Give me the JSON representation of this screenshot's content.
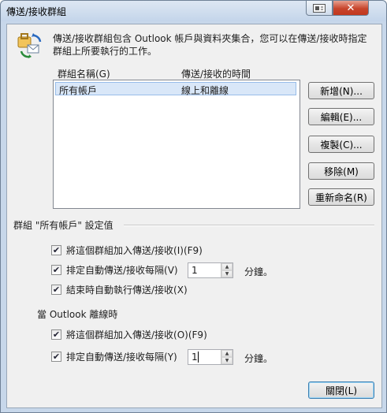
{
  "window": {
    "title": "傳送/接收群組",
    "help_icon": "help-icon",
    "close_icon": "close-icon",
    "close_glyph": "✕"
  },
  "intro": {
    "icon": "send-receive-icon",
    "text": "傳送/接收群組包含 Outlook 帳戶與資料夾集合，您可以在傳送/接收時指定群組上所要執行的工作。"
  },
  "list": {
    "col_name": "群組名稱(G)",
    "col_time": "傳送/接收的時間",
    "rows": [
      {
        "name": "所有帳戶",
        "time": "線上和離線"
      }
    ]
  },
  "buttons": {
    "new": "新增(N)...",
    "edit": "編輯(E)...",
    "copy": "複製(C)...",
    "remove": "移除(M)",
    "rename": "重新命名(R)",
    "close": "關閉(L)"
  },
  "online_settings": {
    "header": "群組 \"所有帳戶\" 設定值",
    "include": {
      "label": "將這個群組加入傳送/接收(I)(F9)",
      "checked": true
    },
    "schedule": {
      "label": "排定自動傳送/接收每隔(V)",
      "checked": true,
      "minutes": "1",
      "unit": "分鐘。"
    },
    "on_exit": {
      "label": "結束時自動執行傳送/接收(X)",
      "checked": true
    }
  },
  "offline_settings": {
    "header": "當 Outlook 離線時",
    "include": {
      "label": "將這個群組加入傳送/接收(O)(F9)",
      "checked": true
    },
    "schedule": {
      "label": "排定自動傳送/接收每隔(Y)",
      "checked": true,
      "minutes": "1",
      "unit": "分鐘。"
    }
  },
  "glyphs": {
    "check": "✔",
    "up": "▲",
    "down": "▼"
  }
}
